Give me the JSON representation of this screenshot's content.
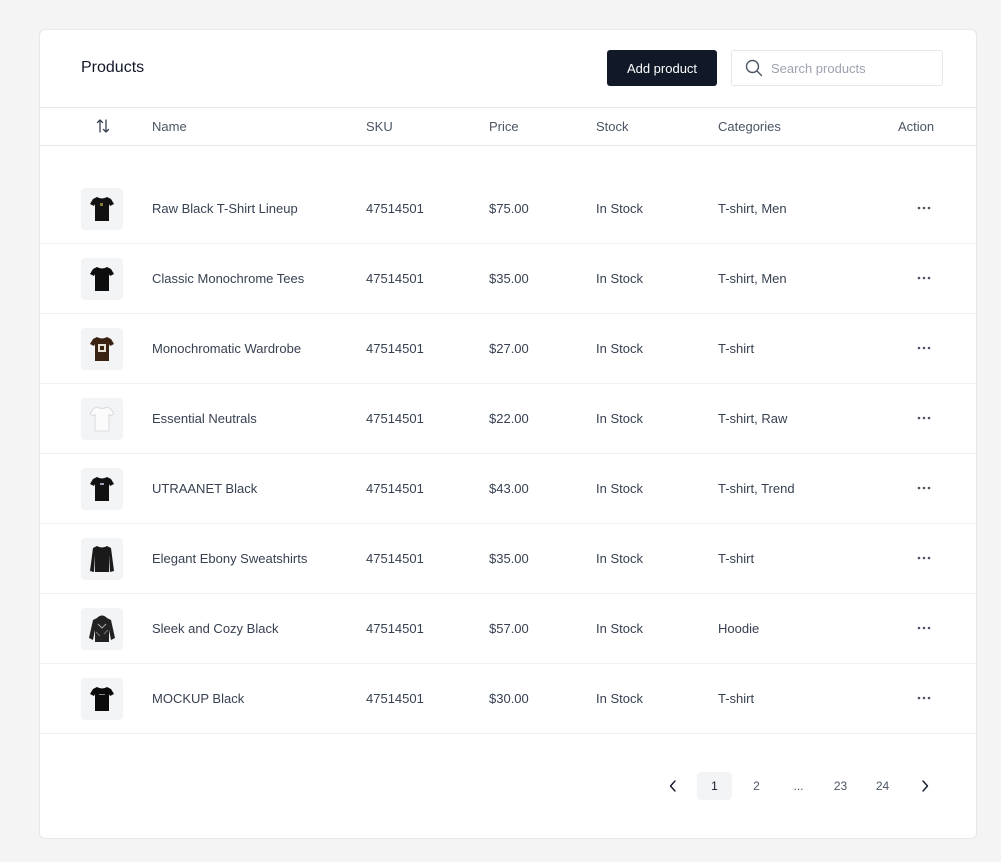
{
  "header": {
    "title": "Products",
    "add_button": "Add product",
    "search_placeholder": "Search products"
  },
  "table": {
    "columns": [
      "Name",
      "SKU",
      "Price",
      "Stock",
      "Categories",
      "Action"
    ],
    "rows": [
      {
        "name": "Raw Black T-Shirt Lineup",
        "sku": "47514501",
        "price": "$75.00",
        "stock": "In Stock",
        "categories": "T-shirt, Men",
        "image": "black-tshirt-icon"
      },
      {
        "name": "Classic Monochrome Tees",
        "sku": "47514501",
        "price": "$35.00",
        "stock": "In Stock",
        "categories": "T-shirt, Men",
        "image": "black-tshirt-icon"
      },
      {
        "name": "Monochromatic Wardrobe",
        "sku": "47514501",
        "price": "$27.00",
        "stock": "In Stock",
        "categories": "T-shirt",
        "image": "brown-tshirt-icon"
      },
      {
        "name": "Essential Neutrals",
        "sku": "47514501",
        "price": "$22.00",
        "stock": "In Stock",
        "categories": "T-shirt, Raw",
        "image": "white-tshirt-icon"
      },
      {
        "name": "UTRAANET Black",
        "sku": "47514501",
        "price": "$43.00",
        "stock": "In Stock",
        "categories": "T-shirt, Trend",
        "image": "black-tshirt-icon"
      },
      {
        "name": "Elegant Ebony Sweatshirts",
        "sku": "47514501",
        "price": "$35.00",
        "stock": "In Stock",
        "categories": "T-shirt",
        "image": "black-sweatshirt-icon"
      },
      {
        "name": "Sleek and Cozy Black",
        "sku": "47514501",
        "price": "$57.00",
        "stock": "In Stock",
        "categories": "Hoodie",
        "image": "black-hoodie-icon"
      },
      {
        "name": "MOCKUP Black",
        "sku": "47514501",
        "price": "$30.00",
        "stock": "In Stock",
        "categories": "T-shirt",
        "image": "black-tshirt-icon"
      }
    ]
  },
  "pagination": {
    "pages": [
      "1",
      "2",
      "...",
      "23",
      "24"
    ],
    "current": "1"
  },
  "colors": {
    "background": "#f4f4f5",
    "card": "#ffffff",
    "primary_button": "#111827",
    "border": "#e5e7eb"
  }
}
